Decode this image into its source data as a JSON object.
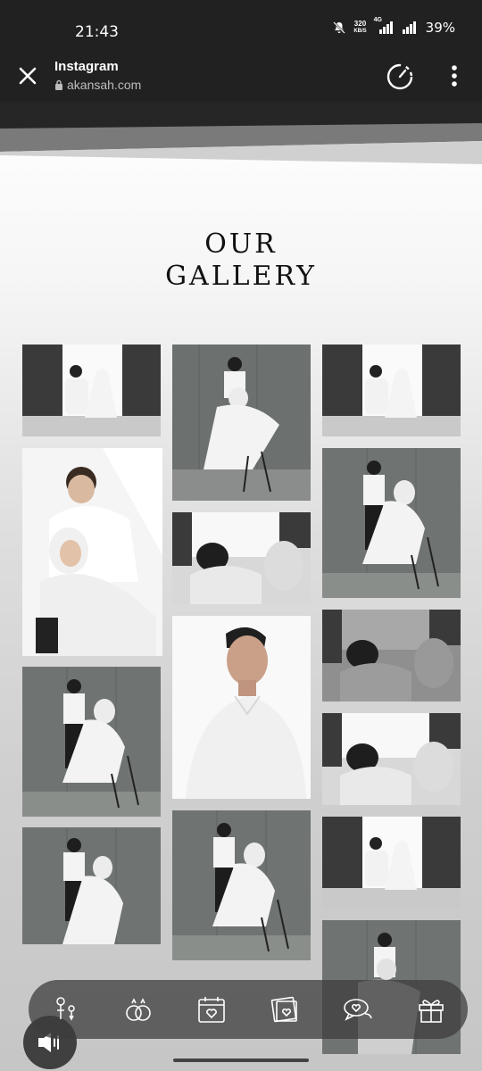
{
  "status_bar": {
    "time": "21:43",
    "speed_value": "320",
    "speed_unit": "KB/S",
    "network": "4G",
    "battery": "39%"
  },
  "browser": {
    "title": "Instagram",
    "url": "akansah.com"
  },
  "gallery": {
    "title_line1": "OUR",
    "title_line2": "GALLERY",
    "photos": [
      "window-couple",
      "studio-couple-chair",
      "window-couple",
      "couple-closeup-bright",
      "studio-couple-standing",
      "couple-closeup-mono",
      "studio-couple-chair",
      "groom-portrait",
      "couple-closeup-mono",
      "studio-couple-chair",
      "studio-couple-chair",
      "couple-closeup-mono",
      "window-couple",
      "studio-couple-standing"
    ]
  },
  "bottom_nav": {
    "items": [
      "couple-icon",
      "rings-icon",
      "calendar-icon",
      "photo-icon",
      "chat-icon",
      "gift-icon"
    ]
  },
  "colors": {
    "status_bg": "#212121",
    "title_text": "#111111",
    "nav_bg": "#3c3c3c"
  }
}
